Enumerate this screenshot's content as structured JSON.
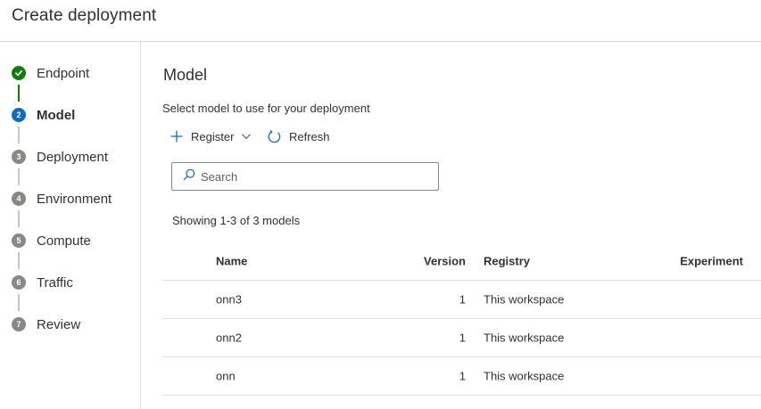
{
  "header": {
    "title": "Create deployment"
  },
  "steps": [
    {
      "number": "",
      "label": "Endpoint",
      "state": "done"
    },
    {
      "number": "2",
      "label": "Model",
      "state": "active"
    },
    {
      "number": "3",
      "label": "Deployment",
      "state": "pending"
    },
    {
      "number": "4",
      "label": "Environment",
      "state": "pending"
    },
    {
      "number": "5",
      "label": "Compute",
      "state": "pending"
    },
    {
      "number": "6",
      "label": "Traffic",
      "state": "pending"
    },
    {
      "number": "7",
      "label": "Review",
      "state": "pending"
    }
  ],
  "main": {
    "section_title": "Model",
    "instruction": "Select model to use for your deployment",
    "toolbar": {
      "register_label": "Register",
      "refresh_label": "Refresh"
    },
    "search": {
      "placeholder": "Search",
      "value": ""
    },
    "showing": "Showing 1-3 of 3 models",
    "table": {
      "columns": {
        "name": "Name",
        "version": "Version",
        "registry": "Registry",
        "experiment": "Experiment"
      },
      "rows": [
        {
          "name": "onn3",
          "version": "1",
          "registry": "This workspace",
          "experiment": ""
        },
        {
          "name": "onn2",
          "version": "1",
          "registry": "This workspace",
          "experiment": ""
        },
        {
          "name": "onn",
          "version": "1",
          "registry": "This workspace",
          "experiment": ""
        }
      ]
    }
  },
  "colors": {
    "accent": "#0f6cbd",
    "done": "#107c10",
    "pending": "#8a8886",
    "text": "#323130",
    "border": "#e1dfdd"
  },
  "icons": {
    "register": "plus-icon",
    "register_menu": "chevron-down-icon",
    "refresh": "refresh-icon",
    "search": "search-icon",
    "done": "checkmark-icon"
  }
}
